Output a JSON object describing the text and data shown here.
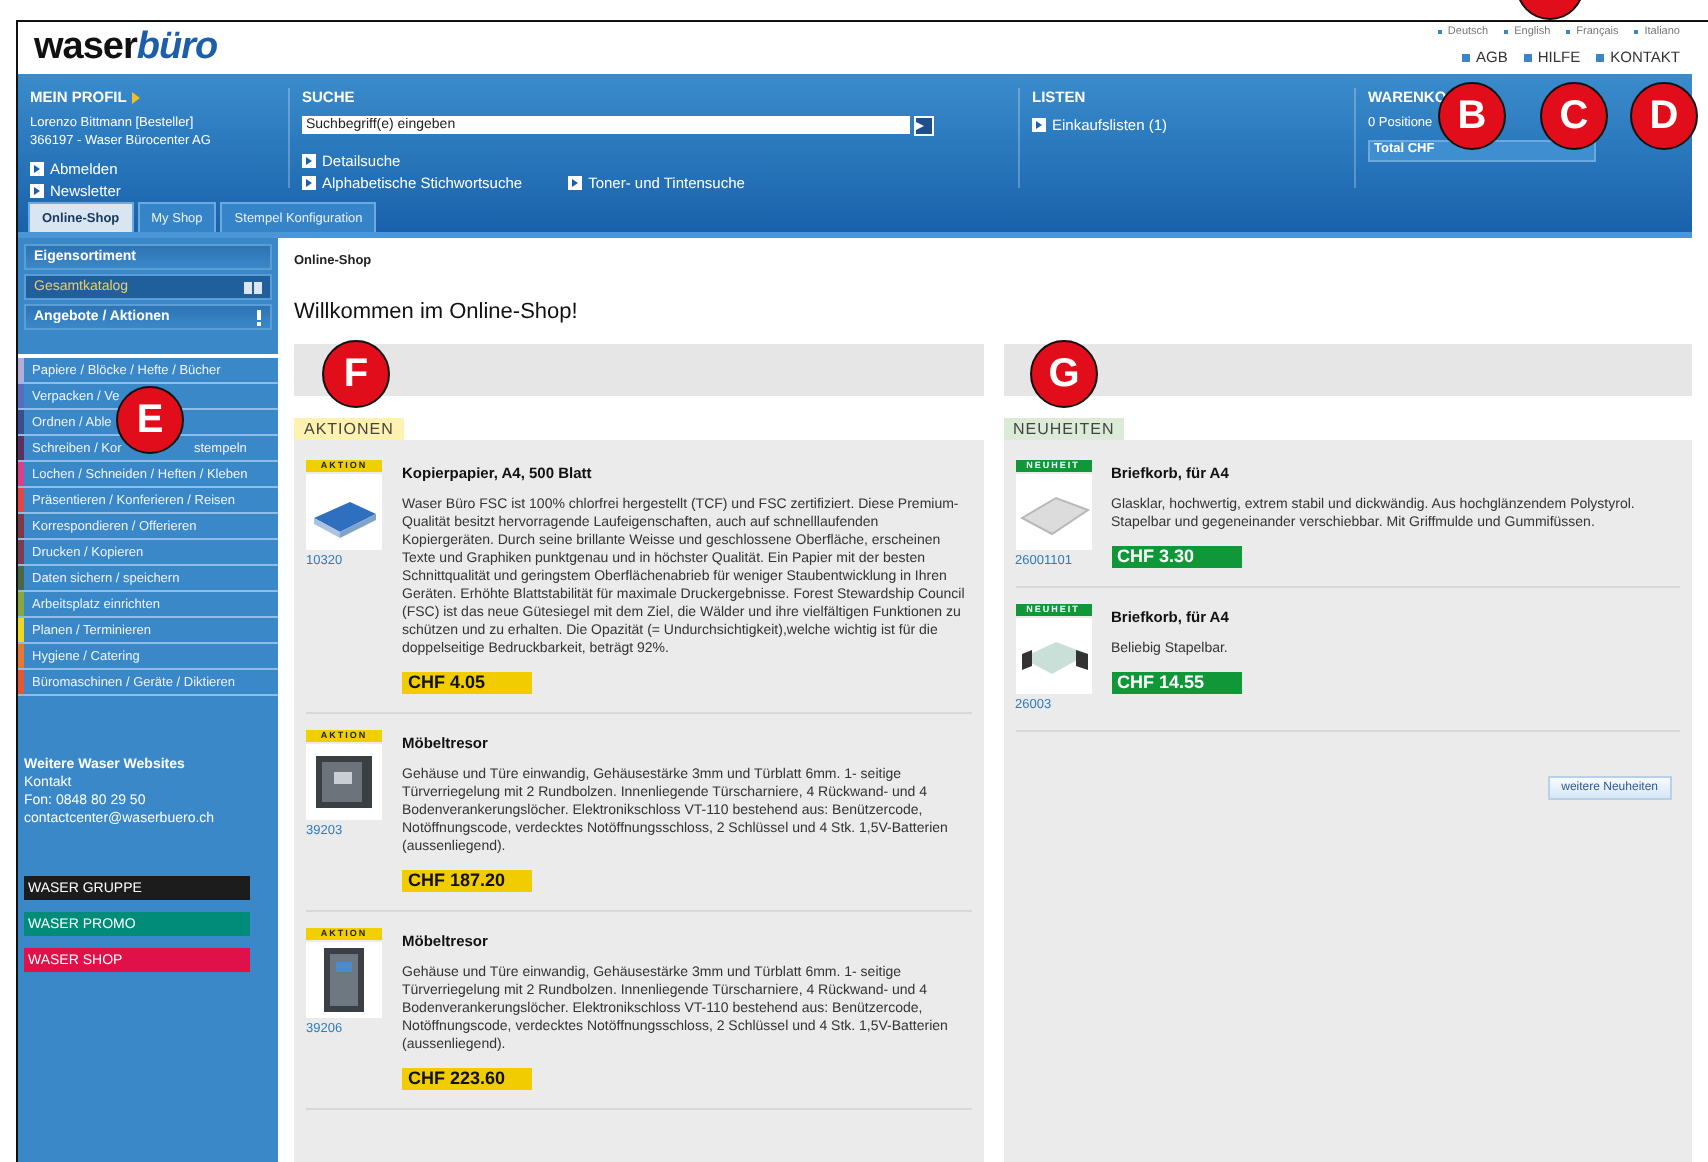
{
  "header": {
    "logo_main": "waser",
    "logo_accent": "büro",
    "languages": [
      "Deutsch",
      "English",
      "Français",
      "Italiano"
    ],
    "top_links": [
      "AGB",
      "HILFE",
      "KONTAKT"
    ],
    "profile": {
      "title": "MEIN PROFIL",
      "user": "Lorenzo Bittmann [Besteller]",
      "company": "366197 - Waser Bürocenter AG",
      "links": [
        "Abmelden",
        "Newsletter"
      ]
    },
    "search": {
      "title": "SUCHE",
      "placeholder": "Suchbegriff(e) eingeben",
      "links": [
        "Detailsuche",
        "Alphabetische Stichwortsuche",
        "Toner- und Tintensuche"
      ]
    },
    "lists": {
      "title": "LISTEN",
      "links": [
        "Einkaufslisten (1)"
      ]
    },
    "cart": {
      "title": "WARENKO",
      "positions": "0 Positione",
      "total": "Total CHF"
    }
  },
  "tabs": [
    {
      "label": "Online-Shop",
      "selected": true
    },
    {
      "label": "My Shop",
      "selected": false
    },
    {
      "label": "Stempel Konfiguration",
      "selected": false
    }
  ],
  "sidebar": {
    "menu": [
      {
        "label": "Eigensortiment",
        "selected": false
      },
      {
        "label": "Gesamtkatalog",
        "selected": true
      },
      {
        "label": "Angebote / Aktionen",
        "selected": false
      }
    ],
    "categories": [
      {
        "label": "Papiere / Blöcke / Hefte / Bücher",
        "color": "#b4acd8"
      },
      {
        "label": "Verpacken / Ve",
        "color": "#5a6cc0"
      },
      {
        "label": "Ordnen / Able",
        "color": "#3c4c90"
      },
      {
        "label": "Schreiben / Kor",
        "tail": "stempeln",
        "color": "#5c3060"
      },
      {
        "label": "Lochen / Schneiden / Heften / Kleben",
        "color": "#d8408c"
      },
      {
        "label": "Präsentieren / Konferieren / Reisen",
        "color": "#e04848"
      },
      {
        "label": "Korrespondieren / Offerieren",
        "color": "#803848"
      },
      {
        "label": "Drucken / Kopieren",
        "color": "#7c3c54"
      },
      {
        "label": "Daten sichern / speichern",
        "color": "#486848"
      },
      {
        "label": "Arbeitsplatz einrichten",
        "color": "#88a840"
      },
      {
        "label": "Planen / Terminieren",
        "color": "#f0d820"
      },
      {
        "label": "Hygiene / Catering",
        "color": "#e87838"
      },
      {
        "label": "Büromaschinen / Geräte / Diktieren",
        "color": "#e05838"
      }
    ],
    "websites": {
      "title": "Weitere Waser Websites",
      "lines": [
        "Kontakt",
        "Fon: 0848 80 29 50",
        "contactcenter@waserbuero.ch"
      ]
    },
    "site_links": [
      {
        "label": "WASER GRUPPE",
        "color": "#1c1c1c"
      },
      {
        "label": "WASER PROMO",
        "color": "#008c78"
      },
      {
        "label": "WASER SHOP",
        "color": "#e01048"
      }
    ]
  },
  "content": {
    "breadcrumb": "Online-Shop",
    "heading": "Willkommen im Online-Shop!",
    "sections": [
      {
        "kind": "aktionen",
        "title": "AKTIONEN",
        "products": [
          {
            "badge": "AKTION",
            "code": "10320",
            "title": "Kopierpapier, A4, 500 Blatt",
            "description": "Waser Büro FSC ist 100% chlorfrei hergestellt (TCF) und FSC zertifiziert. Diese Premium-Qualität besitzt hervorragende Laufeigenschaften, auch auf schnelllaufenden Kopiergeräten. Durch seine brillante Weisse und geschlossene Oberfläche, erscheinen Texte und Graphiken punktgenau und in höchster Qualität. Ein Papier mit der besten Schnittqualität und geringstem Oberflächenabrieb für weniger Staubentwicklung in Ihren Geräten. Erhöhte Blattstabilität für maximale Druckergebnisse. Forest Stewardship Council (FSC) ist das neue Gütesiegel mit dem Ziel, die Wälder und ihre vielfältigen Funktionen zu schützen und zu erhalten. Die Opazität (= Undurchsichtigkeit),welche wichtig ist für die doppelseitige Bedruckbarkeit, beträgt 92%.",
            "price": "CHF 4.05"
          },
          {
            "badge": "AKTION",
            "code": "39203",
            "title": "Möbeltresor",
            "description": "Gehäuse und Türe einwandig, Gehäusestärke 3mm und Türblatt 6mm. 1- seitige Türverriegelung mit 2 Rundbolzen. Innenliegende Türscharniere, 4 Rückwand- und 4 Bodenverankerungslöcher. Elektronikschloss VT-110 bestehend aus: Benützercode, Notöffnungscode, verdecktes Notöffnungsschloss, 2 Schlüssel und 4 Stk. 1,5V-Batterien (aussenliegend).",
            "price": "CHF 187.20"
          },
          {
            "badge": "AKTION",
            "code": "39206",
            "title": "Möbeltresor",
            "description": "Gehäuse und Türe einwandig, Gehäusestärke 3mm und Türblatt 6mm. 1- seitige Türverriegelung mit 2 Rundbolzen. Innenliegende Türscharniere, 4 Rückwand- und 4 Bodenverankerungslöcher. Elektronikschloss VT-110 bestehend aus: Benützercode, Notöffnungscode, verdecktes Notöffnungsschloss, 2 Schlüssel und 4 Stk. 1,5V-Batterien (aussenliegend).",
            "price": "CHF 223.60"
          }
        ]
      },
      {
        "kind": "neuheiten",
        "title": "NEUHEITEN",
        "more": "weitere Neuheiten",
        "products": [
          {
            "badge": "NEUHEIT",
            "code": "26001101",
            "title": "Briefkorb, für A4",
            "description": "Glasklar, hochwertig, extrem stabil und dickwändig. Aus hochglänzendem Polystyrol. Stapelbar und gegeneinander verschiebbar. Mit Griffmulde und Gummifüssen.",
            "price": "CHF 3.30"
          },
          {
            "badge": "NEUHEIT",
            "code": "26003",
            "title": "Briefkorb, für A4",
            "description": "Beliebig Stapelbar.",
            "price": "CHF 14.55"
          }
        ]
      }
    ]
  },
  "callouts": [
    {
      "kind": "partial"
    },
    {
      "kind": "letter",
      "letter": "B"
    },
    {
      "kind": "letter",
      "letter": "C"
    },
    {
      "kind": "letter",
      "letter": "D"
    },
    {
      "kind": "letter",
      "letter": "E"
    },
    {
      "kind": "letter",
      "letter": "F"
    },
    {
      "kind": "letter",
      "letter": "G"
    }
  ]
}
